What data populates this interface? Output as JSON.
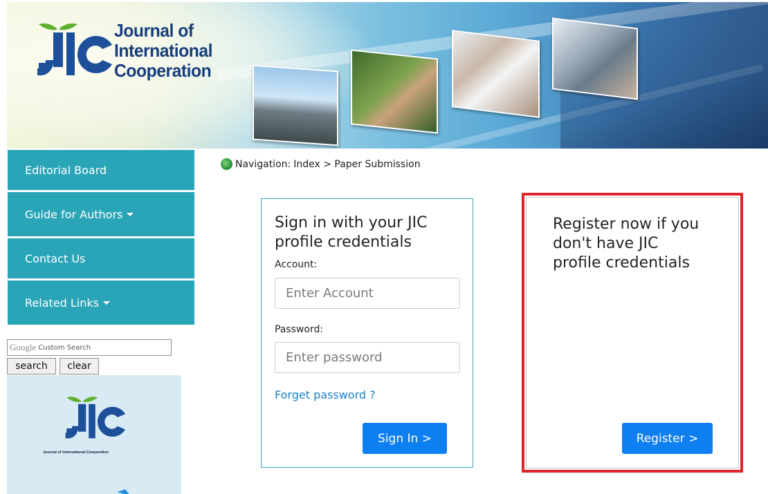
{
  "banner": {
    "journal_line1": "Journal of",
    "journal_line2": "International",
    "journal_line3": "Cooperation",
    "logo_letters": "JIC"
  },
  "sidebar": {
    "items": [
      {
        "label": "Editorial Board",
        "has_dropdown": false
      },
      {
        "label": "Guide for Authors",
        "has_dropdown": true
      },
      {
        "label": "Contact Us",
        "has_dropdown": false
      },
      {
        "label": "Related Links",
        "has_dropdown": true
      }
    ],
    "search": {
      "brand": "Google",
      "placeholder_suffix": "Custom Search",
      "search_label": "search",
      "clear_label": "clear"
    },
    "logo_caption": "Journal of International Cooperation"
  },
  "breadcrumb": {
    "prefix": "Navigation:",
    "path": "Index > Paper Submission"
  },
  "signin": {
    "title_line1": "Sign in with your JIC",
    "title_line2": "profile credentials",
    "account_label": "Account:",
    "account_placeholder": "Enter Account",
    "password_label": "Password:",
    "password_placeholder": "Enter password",
    "forget_label": "Forget password ?",
    "button_label": "Sign In >"
  },
  "register": {
    "title_line1": "Register now if you",
    "title_line2": "don't have JIC",
    "title_line3": "profile credentials",
    "button_label": "Register >"
  },
  "colors": {
    "sidebar_bg": "#2aa5b8",
    "button_blue": "#0d7ff0",
    "highlight_red": "#e0242c",
    "link_blue": "#1a7fc7"
  }
}
